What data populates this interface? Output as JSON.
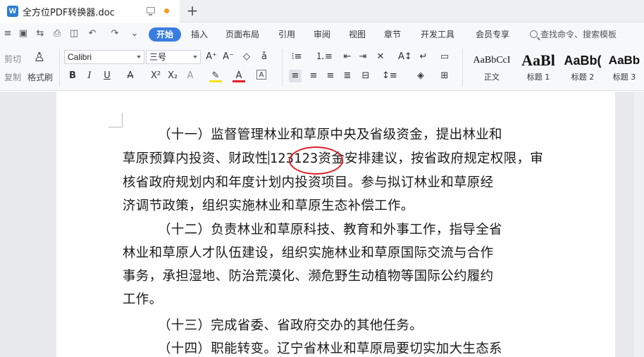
{
  "titlebar": {
    "document_title": "全方位PDF转换器.doc",
    "logo_letter": "W",
    "new_tab_symbol": "+"
  },
  "menubar": {
    "items": [
      "开始",
      "插入",
      "页面布局",
      "引用",
      "审阅",
      "视图",
      "章节",
      "开发工具",
      "会员专享"
    ],
    "active_index": 0,
    "search_placeholder": "查找命令、搜索模板"
  },
  "ribbon": {
    "clipboard": {
      "cut_label": "剪切",
      "copy_label": "复制",
      "format_painter_label": "格式刷"
    },
    "font_name": "Calibri",
    "font_size": "三号",
    "styles": [
      {
        "sample": "AaBbCcI",
        "name": "正文"
      },
      {
        "sample": "AaBl",
        "name": "标题 1"
      },
      {
        "sample": "AaBb(",
        "name": "标题 2"
      },
      {
        "sample": "AaBb",
        "name": "标题 3"
      }
    ]
  },
  "document": {
    "lines": [
      "（十一）监督管理林业和草原中央及省级资金，提出林业和",
      "草原预算内投资、财政性",
      "核省政府规划内和年度计划内投资项目。参与拟订林业和草原经",
      "济调节政策，组织实施林业和草原生态补偿工作。",
      "（十二）负责林业和草原科技、教育和外事工作，指导全省",
      "林业和草原人才队伍建设，组织实施林业和草原国际交流与合作",
      "事务，承担湿地、防治荒漠化、濒危野生动植物等国际公约履约",
      "工作。",
      "（十三）完成省委、省政府交办的其他任务。",
      "（十四）职能转变。辽宁省林业和草原局要切实加大生态系"
    ],
    "inserted_text": "123123",
    "line2_suffix": "资金安排建议，按省政府规定权限，审"
  },
  "colors": {
    "accent": "#3a7de0",
    "annotation_circle": "#e0202a",
    "unsaved_dot": "#f29b1d"
  }
}
